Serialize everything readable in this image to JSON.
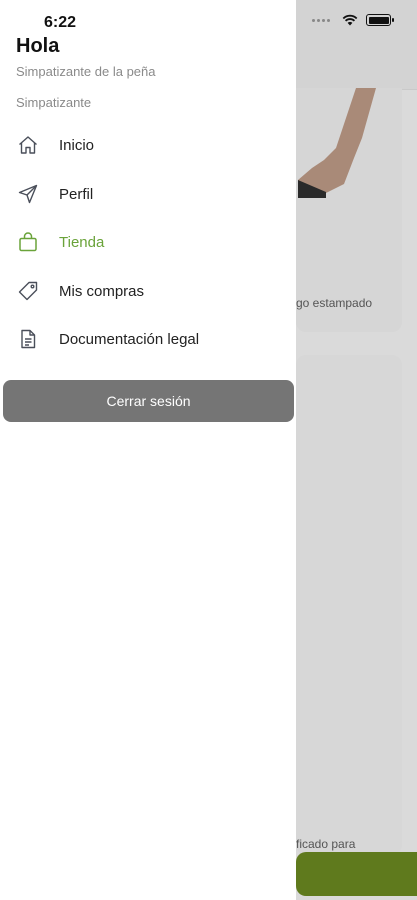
{
  "status_bar": {
    "time": "6:22"
  },
  "drawer": {
    "greeting": "Hola",
    "subtitle": "Simpatizante de la peña",
    "role": "Simpatizante",
    "menu": [
      {
        "label": "Inicio",
        "icon": "home-icon",
        "active": false
      },
      {
        "label": "Perfil",
        "icon": "send-icon",
        "active": false
      },
      {
        "label": "Tienda",
        "icon": "shopping-bag-icon",
        "active": true
      },
      {
        "label": "Mis compras",
        "icon": "tag-icon",
        "active": false
      },
      {
        "label": "Documentación legal",
        "icon": "document-icon",
        "active": false
      }
    ],
    "logout_label": "Cerrar sesión"
  },
  "background": {
    "card1_caption": "go estampado",
    "card2_caption": "ficado para"
  },
  "colors": {
    "accent": "#6aa33a",
    "logout_button": "#757575",
    "green_bar": "#5f7a1d"
  }
}
